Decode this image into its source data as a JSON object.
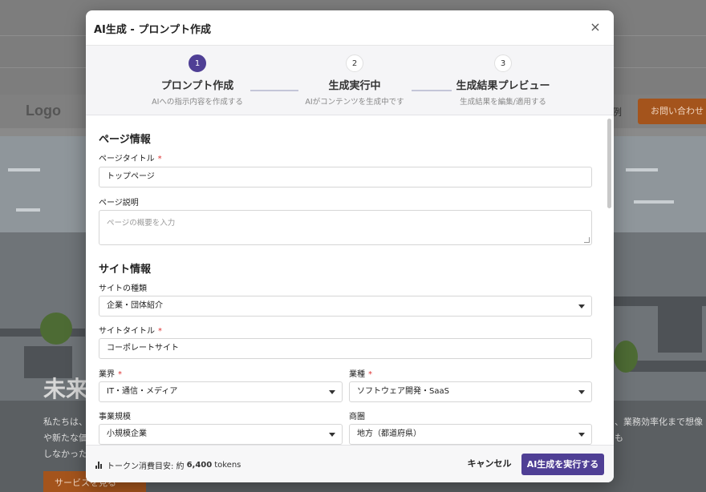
{
  "background": {
    "logo": "Logo",
    "nav_partial": "例",
    "contact_button": "お問い合わせ",
    "hero_title": "未来",
    "hero_text_left": "私たちは、や新たな価しなかった",
    "hero_text_right": "、業務効率化まで想像も",
    "hero_button": "サービスを見る"
  },
  "modal": {
    "title": "AI生成 - プロンプト作成",
    "close_label": "×",
    "steps": [
      {
        "number": "1",
        "label": "プロンプト作成",
        "sub": "AIへの指示内容を作成する",
        "active": true
      },
      {
        "number": "2",
        "label": "生成実行中",
        "sub": "AIがコンテンツを生成中です",
        "active": false
      },
      {
        "number": "3",
        "label": "生成結果プレビュー",
        "sub": "生成結果を編集/適用する",
        "active": false
      }
    ],
    "page_section": {
      "title": "ページ情報",
      "page_title_label": "ページタイトル",
      "page_title_value": "トップページ",
      "page_desc_label": "ページ説明",
      "page_desc_placeholder": "ページの概要を入力"
    },
    "site_section": {
      "title": "サイト情報",
      "site_type_label": "サイトの種類",
      "site_type_value": "企業・団体紹介",
      "site_title_label": "サイトタイトル",
      "site_title_value": "コーポレートサイト",
      "industry_label": "業界",
      "industry_value": "IT・通信・メディア",
      "business_label": "業種",
      "business_value": "ソフトウェア開発・SaaS",
      "scale_label": "事業規模",
      "scale_value": "小規模企業",
      "area_label": "商圏",
      "area_value": "地方（都道府県）"
    },
    "required_mark": "*",
    "footer": {
      "tokens_prefix": "トークン消費目安: 約",
      "tokens_value": "6,400",
      "tokens_unit": "tokens",
      "cancel_label": "キャンセル",
      "run_label": "AI生成を実行する"
    }
  }
}
